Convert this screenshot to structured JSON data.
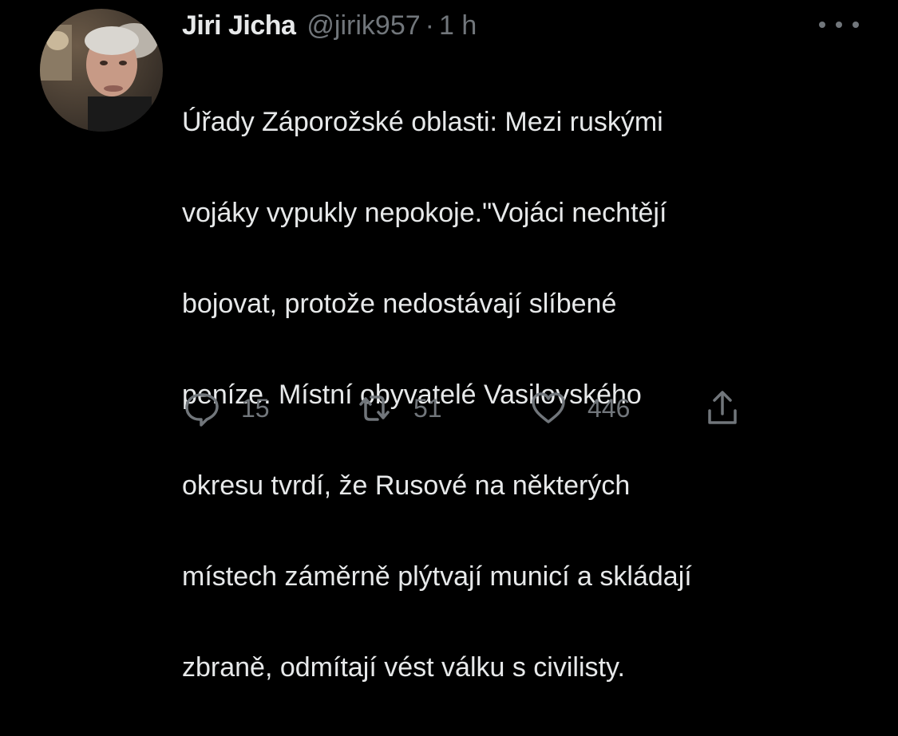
{
  "tweet": {
    "author_name": "Jiri Jicha",
    "handle": "@jirik957",
    "separator": "·",
    "time": "1 h",
    "text_lines": [
      "Úřady Záporožské oblasti: Mezi ruskými",
      "vojáky vypukly nepokoje.\"Vojáci nechtějí",
      "bojovat, protože nedostávají slíbené",
      "peníze. Místní obyvatelé Vasilovského",
      "okresu tvrdí, že Rusové na některých",
      "místech záměrně  plýtvají municí a skládají",
      "zbraně, odmítají vést válku s civilisty."
    ]
  },
  "actions": {
    "reply": {
      "icon": "reply-icon",
      "count": "15"
    },
    "retweet": {
      "icon": "retweet-icon",
      "count": "51"
    },
    "like": {
      "icon": "heart-icon",
      "count": "446"
    },
    "share": {
      "icon": "share-icon"
    }
  },
  "more_menu": {
    "icon": "more-icon"
  },
  "colors": {
    "background": "#000000",
    "primary_text": "#e7e9ea",
    "secondary_text": "#71767b"
  }
}
